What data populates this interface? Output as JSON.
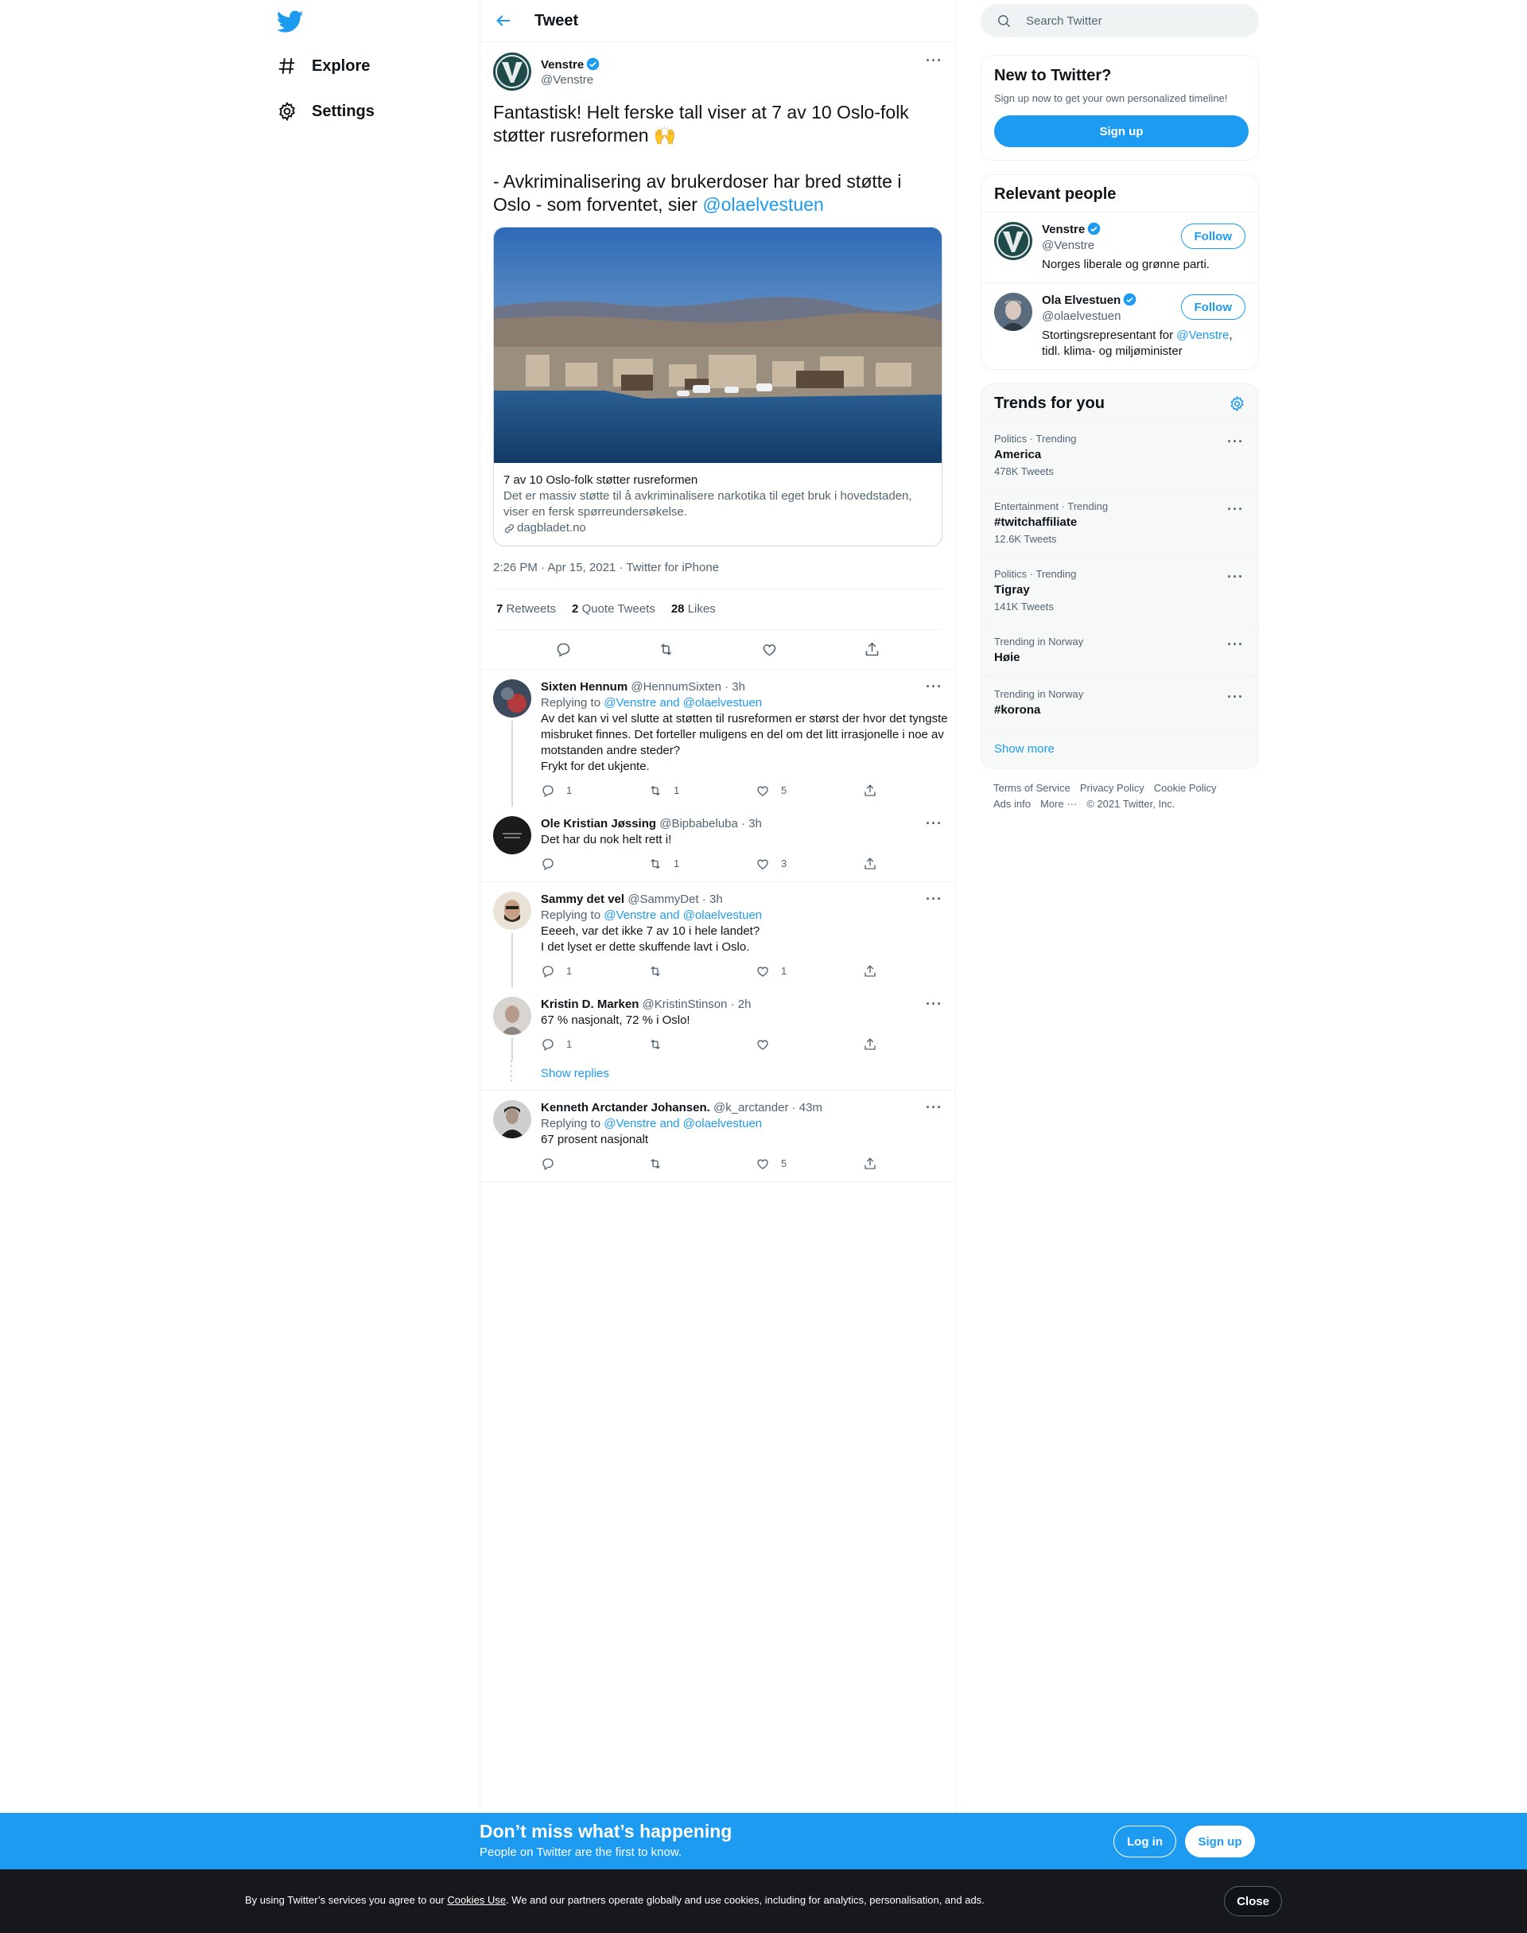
{
  "nav": {
    "items": [
      {
        "label": "Explore",
        "icon": "hashtag-icon"
      },
      {
        "label": "Settings",
        "icon": "gear-icon"
      }
    ]
  },
  "header": {
    "title": "Tweet"
  },
  "main_tweet": {
    "author_name": "Venstre",
    "author_handle": "@Venstre",
    "text_1": "Fantastisk! Helt ferske tall viser at 7 av 10 Oslo-folk støtter rusreformen 🙌\n\n- Avkriminalisering av brukerdoser har bred støtte i Oslo - som forventet, sier ",
    "mention": "@olaelvestuen",
    "card": {
      "title": "7 av 10 Oslo-folk støtter rusreformen",
      "description": "Det er massiv støtte til å avkriminalisere narkotika til eget bruk i hovedstaden, viser en fersk spørreundersøkelse.",
      "domain": "dagbladet.no"
    },
    "meta": "2:26 PM · Apr 15, 2021 · Twitter for iPhone",
    "stats": [
      {
        "count": "7",
        "label": "Retweets"
      },
      {
        "count": "2",
        "label": "Quote Tweets"
      },
      {
        "count": "28",
        "label": "Likes"
      }
    ]
  },
  "replies": [
    {
      "name": "Sixten Hennum",
      "handle": "@HennumSixten · 3h",
      "replying_label": "Replying to ",
      "replying_to": "@Venstre and @olaelvestuen",
      "text": "Av det kan vi vel slutte at støtten til rusreformen er størst der hvor det tyngste misbruket finnes. Det forteller muligens en del om det litt irrasjonelle i noe av motstanden andre steder?\nFrykt for det ukjente.",
      "reply_count": "1",
      "retweet_count": "1",
      "like_count": "5"
    },
    {
      "name": "Ole Kristian Jøssing",
      "handle": "@Bipbabeluba · 3h",
      "text": "Det har du nok helt rett i!",
      "reply_count": "",
      "retweet_count": "1",
      "like_count": "3"
    },
    {
      "name": "Sammy det vel",
      "handle": "@SammyDet · 3h",
      "replying_label": "Replying to ",
      "replying_to": "@Venstre and @olaelvestuen",
      "text": "Eeeeh, var det ikke 7 av 10 i hele landet?\nI det lyset er dette skuffende lavt i Oslo.",
      "reply_count": "1",
      "retweet_count": "",
      "like_count": "1"
    },
    {
      "name": "Kristin D. Marken",
      "handle": "@KristinStinson · 2h",
      "text": "67 % nasjonalt, 72 % i Oslo!",
      "reply_count": "1",
      "retweet_count": "",
      "like_count": ""
    },
    {
      "name": "Kenneth Arctander Johansen.",
      "handle": "@k_arctander · 43m",
      "replying_label": "Replying to ",
      "replying_to": "@Venstre and @olaelvestuen",
      "text": "67 prosent nasjonalt",
      "reply_count": "",
      "retweet_count": "",
      "like_count": "5"
    }
  ],
  "show_replies": "Show replies",
  "search": {
    "placeholder": "Search Twitter"
  },
  "new_panel": {
    "title": "New to Twitter?",
    "subtitle": "Sign up now to get your own personalized timeline!",
    "signup": "Sign up"
  },
  "relevant": {
    "title": "Relevant people",
    "people": [
      {
        "name": "Venstre",
        "handle": "@Venstre",
        "bio": "Norges liberale og grønne parti.",
        "follow": "Follow"
      },
      {
        "name": "Ola Elvestuen",
        "handle": "@olaelvestuen",
        "bio_1": "Stortingsrepresentant for ",
        "bio_link": "@Venstre",
        "bio_2": ", tidl. klima- og miljøminister",
        "follow": "Follow"
      }
    ]
  },
  "trends": {
    "title": "Trends for you",
    "items": [
      {
        "context": "Politics · Trending",
        "topic": "America",
        "count": "478K Tweets"
      },
      {
        "context": "Entertainment · Trending",
        "topic": "#twitchaffiliate",
        "count": "12.6K Tweets"
      },
      {
        "context": "Politics · Trending",
        "topic": "Tigray",
        "count": "141K Tweets"
      },
      {
        "context": "Trending in Norway",
        "topic": "Høie",
        "count": ""
      },
      {
        "context": "Trending in Norway",
        "topic": "#korona",
        "count": ""
      }
    ],
    "show_more": "Show more"
  },
  "footer": {
    "links": [
      "Terms of Service",
      "Privacy Policy",
      "Cookie Policy",
      "Ads info",
      "More ···",
      "© 2021 Twitter, Inc."
    ]
  },
  "bottom_bar": {
    "headline": "Don’t miss what’s happening",
    "sub": "People on Twitter are the first to know.",
    "login": "Log in",
    "signup": "Sign up"
  },
  "cookie": {
    "pre": "By using Twitter’s services you agree to our ",
    "link": "Cookies Use",
    "post": ". We and our partners operate globally and use cookies, including for analytics, personalisation, and ads.",
    "close": "Close"
  },
  "colors": {
    "accent": "#1d9bf0",
    "text": "#0f1419",
    "muted": "#536471",
    "cookie_bg": "#16181c"
  }
}
